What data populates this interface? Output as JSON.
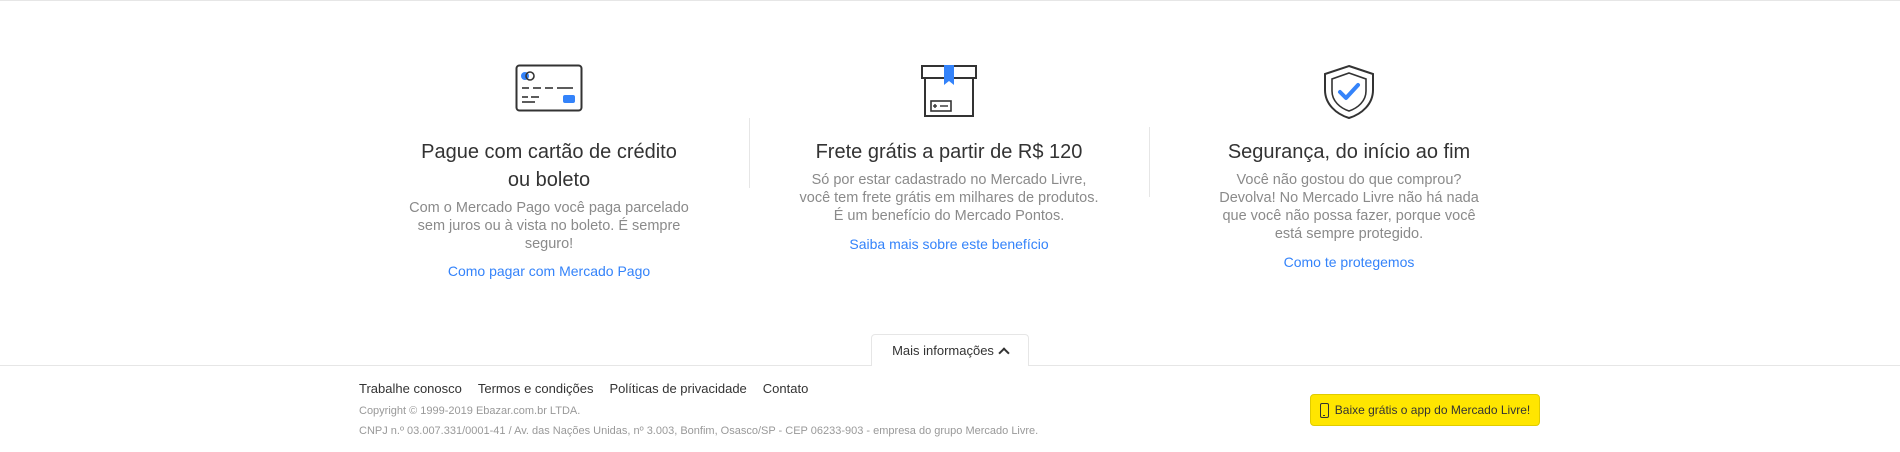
{
  "benefits": [
    {
      "icon": "credit-card-icon",
      "title": "Pague com cartão de crédito ou boleto",
      "text": "Com o Mercado Pago você paga parcelado sem juros ou à vista no boleto. É sempre seguro!",
      "link": "Como pagar com Mercado Pago"
    },
    {
      "icon": "package-icon",
      "title": "Frete grátis a partir de R$ 120",
      "text": "Só por estar cadastrado no Mercado Livre, você tem frete grátis em milhares de produtos. É um benefício do Mercado Pontos.",
      "link": "Saiba mais sobre este benefício"
    },
    {
      "icon": "shield-check-icon",
      "title": "Segurança, do início ao fim",
      "text": "Você não gostou do que comprou? Devolva! No Mercado Livre não há nada que você não possa fazer, porque você está sempre protegido.",
      "link": "Como te protegemos"
    }
  ],
  "more_info": {
    "label": "Mais informações"
  },
  "footer": {
    "links": [
      "Trabalhe conosco",
      "Termos e condições",
      "Políticas de privacidade",
      "Contato"
    ],
    "copyright": "Copyright © 1999-2019 Ebazar.com.br LTDA.",
    "address": "CNPJ n.º 03.007.331/0001-41 / Av. das Nações Unidas, nº 3.003, Bonfim, Osasco/SP - CEP 06233-903 - empresa do grupo Mercado Livre.",
    "app_button": "Baixe grátis o app do Mercado Livre!"
  },
  "colors": {
    "link": "#3483fa",
    "accent": "#ffe600",
    "icon_blue": "#3483fa"
  }
}
